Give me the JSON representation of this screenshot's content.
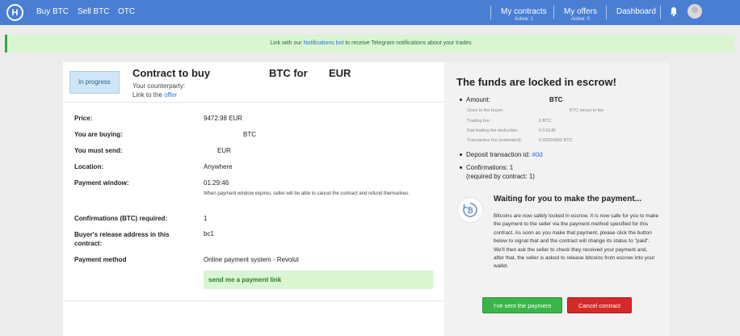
{
  "nav": {
    "logo_glyph": "H",
    "buy": "Buy BTC",
    "sell": "Sell BTC",
    "otc": "OTC",
    "contracts": {
      "label": "My contracts",
      "sub": "Active: 1"
    },
    "offers": {
      "label": "My offers",
      "sub": "Active: 0"
    },
    "dashboard": "Dashboard",
    "bell_icon": "bell-icon",
    "avatar_icon": "user-avatar"
  },
  "banner": {
    "pre": "Link with our ",
    "link": "Notifications bot",
    "post": " to receive Telegram notifications about your trades"
  },
  "contract": {
    "status": "in progress",
    "title_prefix": "Contract to buy",
    "title_mid": "BTC for",
    "title_cur": "EUR",
    "counterparty": "Your counterparty:",
    "link_to": "Link to the ",
    "offer_link": "offer"
  },
  "details": {
    "price": {
      "label": "Price:",
      "value": "9472.98 EUR"
    },
    "buying": {
      "label": "You are buying:",
      "value": "BTC"
    },
    "send": {
      "label": "You must send:",
      "value": "EUR"
    },
    "location": {
      "label": "Location:",
      "value": "Anywhere"
    },
    "window": {
      "label": "Payment window:",
      "value": "01:29:46",
      "note": "When payment window expires, seller will be able to cancel the contract and refund themselves."
    },
    "confirmations": {
      "label": "Confirmations (BTC) required:",
      "value": "1"
    },
    "release": {
      "label": "Buyer's release address in this contract:",
      "value": "bc1"
    },
    "method": {
      "label": "Payment method",
      "value": "Online payment system - Revolut"
    },
    "payment_link": "send me a payment link"
  },
  "escrow": {
    "title": "The funds are locked in escrow!",
    "amount_label": "Amount:",
    "amount_value": "BTC",
    "goes_label": "Goes to the buyer:",
    "goes_value": "BTC minus tx fee",
    "trading_fee_label": "Trading fee:",
    "trading_fee_value": "0 BTC",
    "fiat_fee_label": "Fiat trading fee deduction:",
    "fiat_fee_value": "0.0 EUR",
    "tx_fee_label": "Transaction fee (estimated):",
    "tx_fee_value": "0.00024956 BTC",
    "deposit_label": "Deposit transaction id: ",
    "deposit_value": "#0d",
    "confirm_label": "Confirmations: ",
    "confirm_value": "1",
    "required_note": "(required by contract: 1)"
  },
  "waiting": {
    "icon": "bitcoin-clock-icon",
    "title": "Waiting for you to make the payment...",
    "text": "Bitcoins are now safely locked in escrow. It is now safe for you to make the payment to the seller via the payment method specified for this contract. As soon as you make that payment, please click the button below to signal that and the contract will change its status to \"paid\". We'll then ask the seller to check they received your payment and, after that, the seller is asked to release bitcoins from escrow into your wallet."
  },
  "buttons": {
    "sent": "I've sent the payment",
    "cancel": "Cancel contract"
  },
  "colors": {
    "nav": "#4a7ed3",
    "green": "#3ab54a",
    "red": "#d62a2a",
    "link": "#2a73d6"
  }
}
